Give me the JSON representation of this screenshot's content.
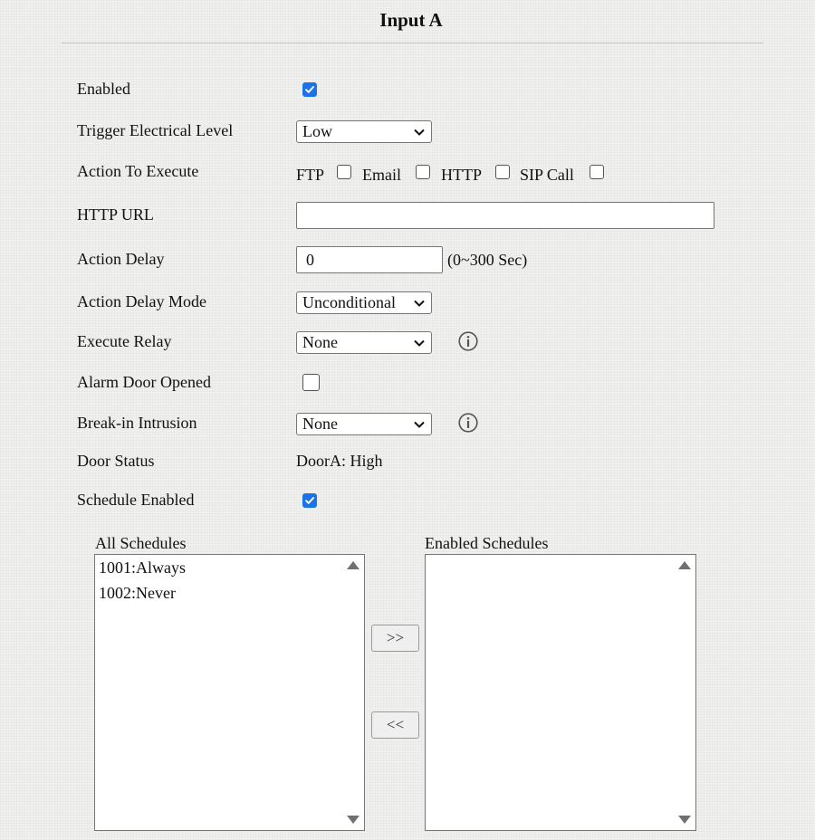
{
  "page": {
    "title": "Input A"
  },
  "fields": {
    "enabled": {
      "label": "Enabled",
      "checked": true
    },
    "trigger_level": {
      "label": "Trigger Electrical Level",
      "value": "Low"
    },
    "action_to_execute": {
      "label": "Action To Execute",
      "options": [
        {
          "label": "FTP",
          "checked": false
        },
        {
          "label": "Email",
          "checked": false
        },
        {
          "label": "HTTP",
          "checked": false
        },
        {
          "label": "SIP Call",
          "checked": false
        }
      ]
    },
    "http_url": {
      "label": "HTTP URL",
      "value": ""
    },
    "action_delay": {
      "label": "Action Delay",
      "value": "0",
      "hint": "(0~300 Sec)"
    },
    "action_delay_mode": {
      "label": "Action Delay Mode",
      "value": "Unconditional"
    },
    "execute_relay": {
      "label": "Execute Relay",
      "value": "None"
    },
    "alarm_door_opened": {
      "label": "Alarm Door Opened",
      "checked": false
    },
    "break_in_intrusion": {
      "label": "Break-in Intrusion",
      "value": "None"
    },
    "door_status": {
      "label": "Door Status",
      "value": "DoorA: High"
    },
    "schedule_enabled": {
      "label": "Schedule Enabled",
      "checked": true
    }
  },
  "schedules": {
    "all_label": "All Schedules",
    "enabled_label": "Enabled Schedules",
    "all_items": [
      "1001:Always",
      "1002:Never"
    ],
    "enabled_items": [],
    "add_button": ">>",
    "remove_button": "<<"
  },
  "colors": {
    "accent": "#1a73e8",
    "rule": "#b6c8e0"
  },
  "icons": {
    "info": "info-circle-icon",
    "check": "checkmark-icon",
    "dropdown": "chevron-down-icon"
  }
}
